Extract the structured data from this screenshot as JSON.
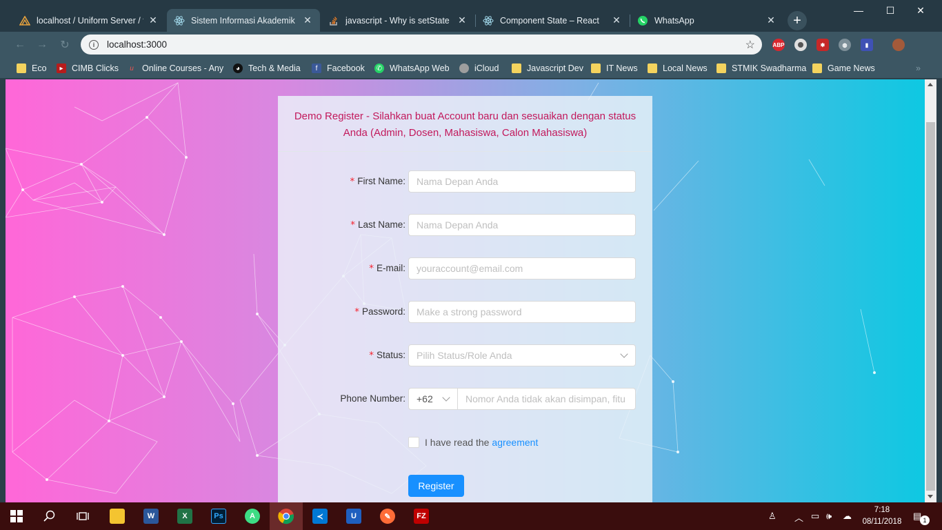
{
  "browser": {
    "tabs": [
      {
        "title": "localhost / Uniform Server / tu",
        "icon": "uniform-server-icon",
        "active": false
      },
      {
        "title": "Sistem Informasi Akademik Ka",
        "icon": "react-icon",
        "active": true
      },
      {
        "title": "javascript - Why is setState in",
        "icon": "stackoverflow-icon",
        "active": false
      },
      {
        "title": "Component State – React",
        "icon": "react-icon",
        "active": false
      },
      {
        "title": "WhatsApp",
        "icon": "whatsapp-icon",
        "active": false
      }
    ],
    "url": "localhost:3000",
    "bookmarks": [
      {
        "label": "Eco",
        "icon": "folder-icon"
      },
      {
        "label": "CIMB Clicks",
        "icon": "cimb-icon"
      },
      {
        "label": "Online Courses - Any",
        "icon": "udemy-icon"
      },
      {
        "label": "Tech & Media",
        "icon": "github-icon"
      },
      {
        "label": "Facebook",
        "icon": "facebook-icon"
      },
      {
        "label": "WhatsApp Web",
        "icon": "whatsapp-icon"
      },
      {
        "label": "iCloud",
        "icon": "apple-icon"
      },
      {
        "label": "Javascript Dev",
        "icon": "folder-icon"
      },
      {
        "label": "IT News",
        "icon": "folder-icon"
      },
      {
        "label": "Local News",
        "icon": "folder-icon"
      },
      {
        "label": "STMIK Swadharma",
        "icon": "folder-icon"
      },
      {
        "label": "Game News",
        "icon": "folder-icon"
      }
    ],
    "extensions": {
      "abp": "ABP"
    }
  },
  "form": {
    "header": "Demo Register - Silahkan buat Account baru dan sesuaikan dengan status Anda (Admin, Dosen, Mahasiswa, Calon Mahasiswa)",
    "required_mark": "*",
    "fields": {
      "first_name": {
        "label": "First Name",
        "placeholder": "Nama Depan Anda"
      },
      "last_name": {
        "label": "Last Name",
        "placeholder": "Nama Depan Anda"
      },
      "email": {
        "label": "E-mail",
        "placeholder": "youraccount@email.com"
      },
      "password": {
        "label": "Password",
        "placeholder": "Make a strong password"
      },
      "status": {
        "label": "Status",
        "placeholder": "Pilih Status/Role Anda"
      },
      "phone": {
        "label": "Phone Number",
        "prefix": "+62",
        "placeholder": "Nomor Anda tidak akan disimpan, fitu"
      }
    },
    "agreement": {
      "text": "I have read the",
      "link": "agreement"
    },
    "submit_label": "Register",
    "colors": {
      "header_text": "#c2185b",
      "primary": "#1890ff",
      "required": "#f5222d"
    }
  },
  "taskbar": {
    "apps": [
      "start",
      "search",
      "task-view",
      "file-explorer",
      "word",
      "excel",
      "photoshop",
      "android-studio",
      "chrome",
      "vscode",
      "uniform-server",
      "postman",
      "filezilla"
    ],
    "clock": {
      "time": "7:18",
      "date": "08/11/2018"
    },
    "notification_count": "1"
  }
}
